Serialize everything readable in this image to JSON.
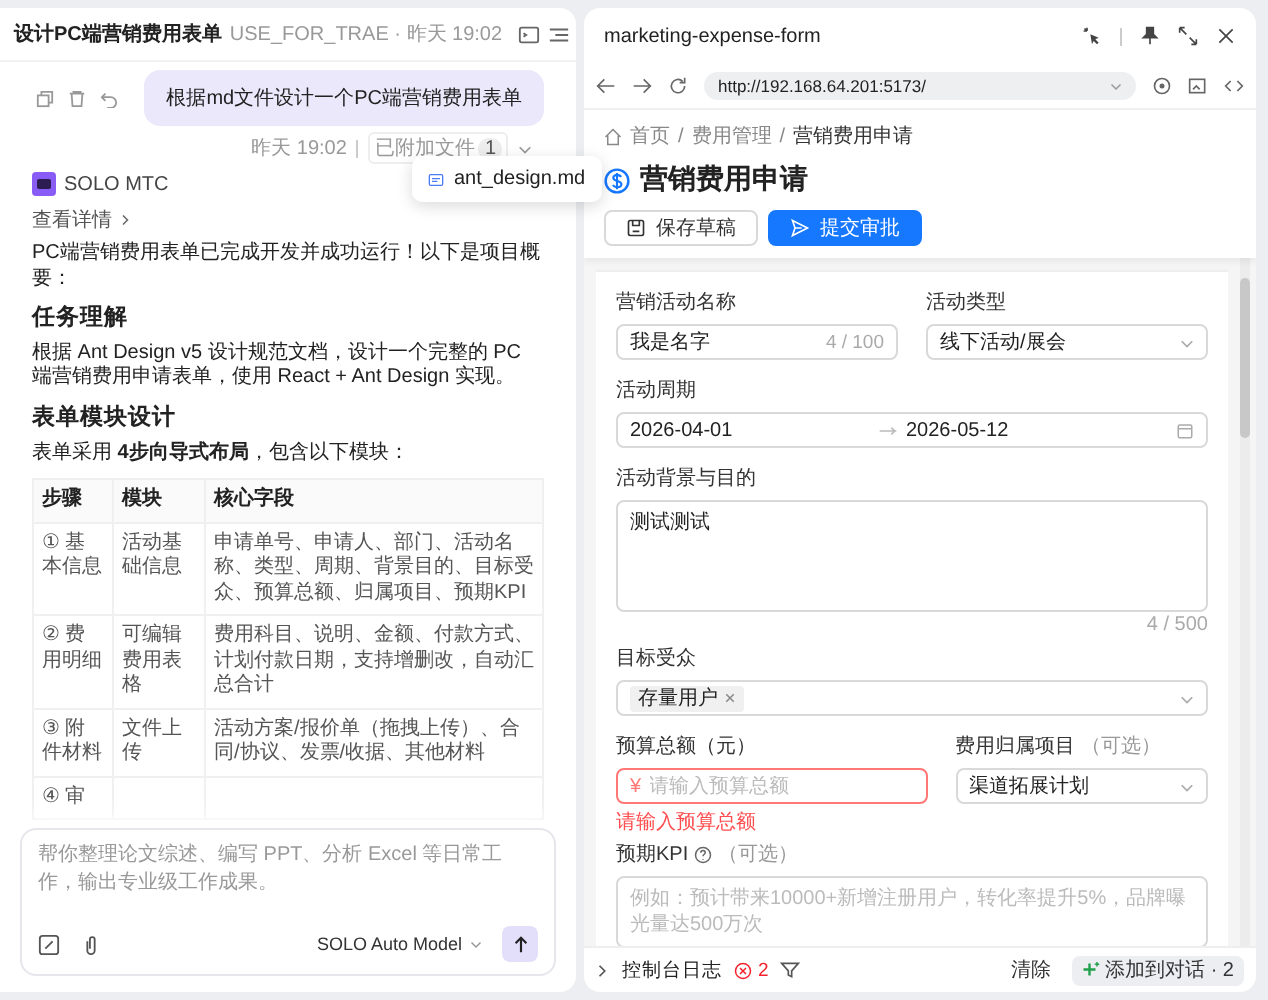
{
  "chat": {
    "title": "设计PC端营销费用表单",
    "subtitle": "USE_FOR_TRAE · 昨天 19:02",
    "user_message": "根据md文件设计一个PC端营销费用表单",
    "meta_time": "昨天 19:02",
    "attached_label": "已附加文件",
    "attached_count": "1",
    "attached_files": [
      "ant_design.md"
    ],
    "assistant_name": "SOLO MTC",
    "details_link": "查看详情",
    "intro": "PC端营销费用表单已完成开发并成功运行！以下是项目概要：",
    "task_heading": "任务理解",
    "task_text": "根据 Ant Design v5 设计规范文档，设计一个完整的 PC 端营销费用申请表单，使用 React + Ant Design 实现。",
    "module_heading": "表单模块设计",
    "module_text": "表单采用 **4步向导式布局**，包含以下模块：",
    "table": {
      "columns": [
        "步骤",
        "模块",
        "核心字段"
      ],
      "rows": [
        [
          "① 基本信息",
          "活动基础信息",
          "申请单号、申请人、部门、活动名称、类型、周期、背景目的、目标受众、预算总额、归属项目、预期KPI"
        ],
        [
          "② 费用明细",
          "可编辑费用表格",
          "费用科目、说明、金额、付款方式、计划付款日期，支持增删改，自动汇总合计"
        ],
        [
          "③ 附件材料",
          "文件上传",
          "活动方案/报价单（拖拽上传）、合同/协议、发票/收据、其他材料"
        ],
        [
          "④ 审"
        ]
      ]
    }
  },
  "composer": {
    "placeholder": "帮你整理论文综述、编写 PPT、分析 Excel 等日常工作，输出专业级工作成果。",
    "model": "SOLO Auto Model"
  },
  "browser": {
    "title": "marketing-expense-form",
    "url": "http://192.168.64.201:5173/",
    "breadcrumb": {
      "separator": "/",
      "items": [
        "首页",
        "费用管理",
        "营销费用申请"
      ]
    },
    "page_title": "营销费用申请",
    "buttons": [
      {
        "label": "保存草稿",
        "kind": "default"
      },
      {
        "label": "提交审批",
        "kind": "primary"
      }
    ],
    "form_rows": [
      {
        "fields": [
          {
            "kind": "input",
            "label": "营销活动名称",
            "value": "我是名字",
            "count": "4 / 100"
          },
          {
            "kind": "select",
            "label": "活动类型",
            "value": "线下活动/展会"
          }
        ]
      },
      {
        "fields": [
          {
            "kind": "date_range",
            "label": "活动周期",
            "start": "2026-04-01",
            "end": "2026-05-12"
          }
        ]
      },
      {
        "fields": [
          {
            "kind": "textarea",
            "label": "活动背景与目的",
            "value": "测试测试",
            "count": "4 / 500"
          }
        ]
      },
      {
        "fields": [
          {
            "kind": "tags",
            "label": "目标受众",
            "tags": [
              "存量用户"
            ]
          }
        ]
      },
      {
        "fields": [
          {
            "kind": "currency",
            "label": "预算总额（元）",
            "prefix": "¥",
            "placeholder": "请输入预算总额",
            "error": "请输入预算总额"
          },
          {
            "kind": "select",
            "label": "费用归属项目",
            "optional": "（可选）",
            "value": "渠道拓展计划"
          }
        ]
      },
      {
        "fields": [
          {
            "kind": "textarea",
            "label": "预期KPI",
            "help": true,
            "optional": "（可选）",
            "placeholder": "例如：预计带来10000+新增注册用户，转化率提升5%，品牌曝光量达500万次"
          }
        ]
      }
    ]
  },
  "console": {
    "label": "控制台日志",
    "error_count": "2",
    "clear": "清除",
    "add_to_chat": "添加到对话 · 2"
  }
}
